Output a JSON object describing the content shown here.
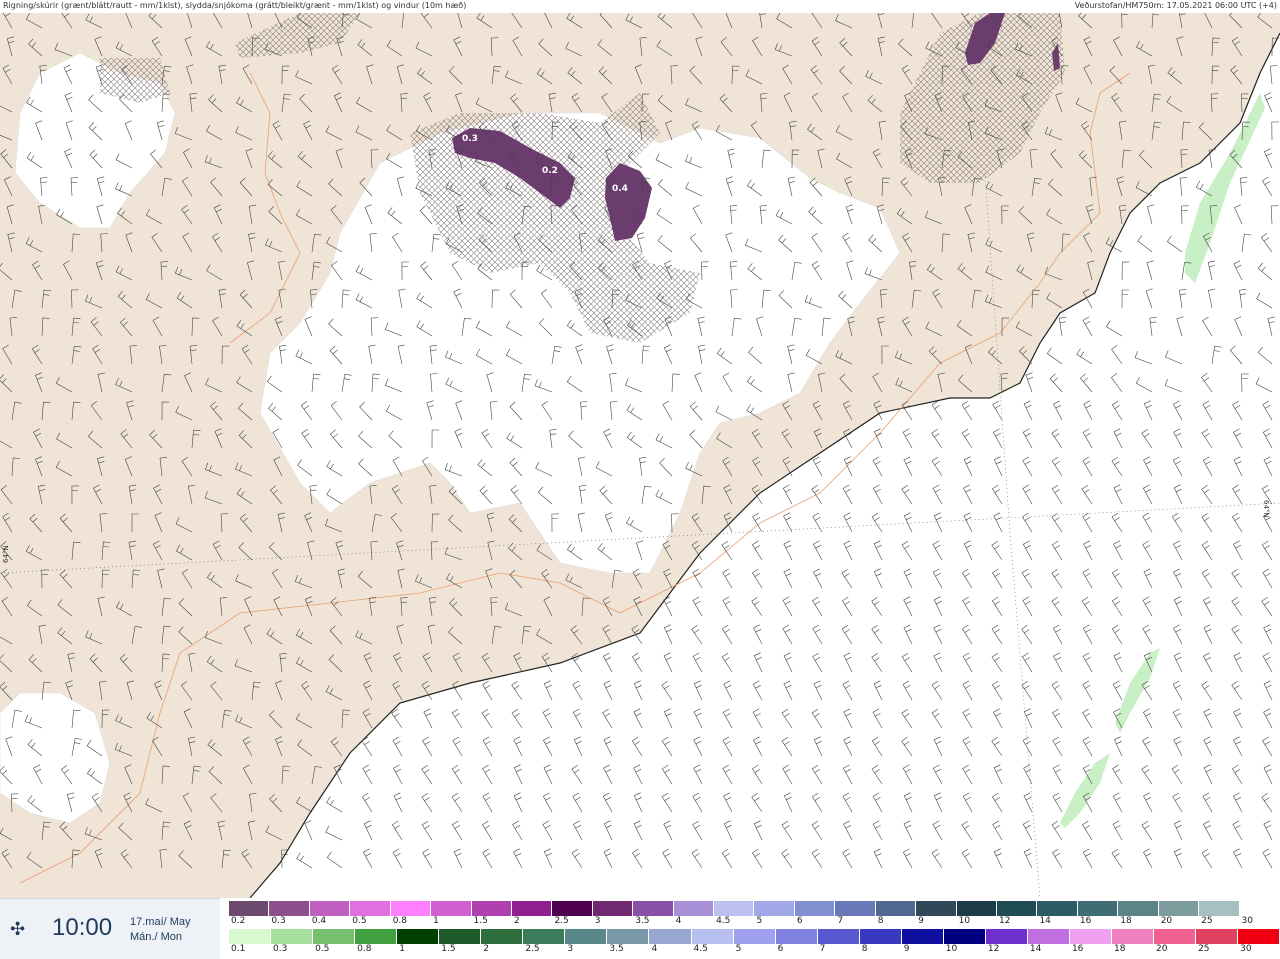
{
  "header": {
    "title_left": "Rigning/skúrir (grænt/blátt/rautt - mm/1klst), slydda/snjókoma (grátt/bleikt/grænt - mm/1klst) og vindur (10m hæð)",
    "title_right": "Veðurstofan/HM750m: 17.05.2021 06:00 UTC (+4)"
  },
  "map": {
    "latitude_label_left": "64°N",
    "latitude_label_right": "64°N",
    "precip_labels": [
      "0.3",
      "0.2",
      "0.4"
    ],
    "colors": {
      "land": "#f0e4d6",
      "glacier": "#ffffff",
      "sea": "#ffffff",
      "coast": "#222222",
      "roads": "#e8a070",
      "snow_purple": "#6b3d6e",
      "rain_green": "#c8f0c4",
      "hatch": "#8a8080"
    }
  },
  "footer": {
    "time": "10:00",
    "date_line1": "17.maí/ May",
    "date_line2": "Mán./ Mon",
    "time_icon": "crosshair-star-icon",
    "scale_top": {
      "labels": [
        "0.2",
        "0.3",
        "0.4",
        "0.5",
        "0.8",
        "1",
        "1.5",
        "2",
        "2.5",
        "3",
        "3.5",
        "4",
        "4.5",
        "5",
        "6",
        "7",
        "8",
        "9",
        "10",
        "12",
        "14",
        "16",
        "18",
        "20",
        "25",
        "30"
      ],
      "colors": [
        "#6b4a6e",
        "#8e4f8e",
        "#c060c0",
        "#e070e0",
        "#ff80ff",
        "#d060d0",
        "#b040b0",
        "#902090",
        "#500050",
        "#702870",
        "#8a50a8",
        "#a890d8",
        "#c0c0f0",
        "#a0a8e8",
        "#8090d0",
        "#6878b8",
        "#506890",
        "#304858",
        "#1c3c48",
        "#204c54",
        "#2e5c64",
        "#3e6e74",
        "#5a8488",
        "#7c9c9e",
        "#a6c0c0",
        "#ffffff"
      ]
    },
    "scale_bottom": {
      "labels": [
        "0.1",
        "0.3",
        "0.5",
        "0.8",
        "1",
        "1.5",
        "2",
        "2.5",
        "3",
        "3.5",
        "4",
        "4.5",
        "5",
        "6",
        "7",
        "8",
        "9",
        "10",
        "12",
        "14",
        "16",
        "18",
        "20",
        "25",
        "30"
      ],
      "colors": [
        "#d8f8d0",
        "#a8e0a0",
        "#78c070",
        "#40a040",
        "#004000",
        "#1e5a2a",
        "#2e6e3c",
        "#3c7c5a",
        "#5a8888",
        "#7898a8",
        "#98a8d0",
        "#b8c0f0",
        "#a0a0f0",
        "#8080e0",
        "#5858d0",
        "#3838c0",
        "#1010a0",
        "#000080",
        "#7030d0",
        "#c070e0",
        "#f0a0f0",
        "#f080c0",
        "#f06090",
        "#e04060",
        "#f00010"
      ]
    }
  }
}
